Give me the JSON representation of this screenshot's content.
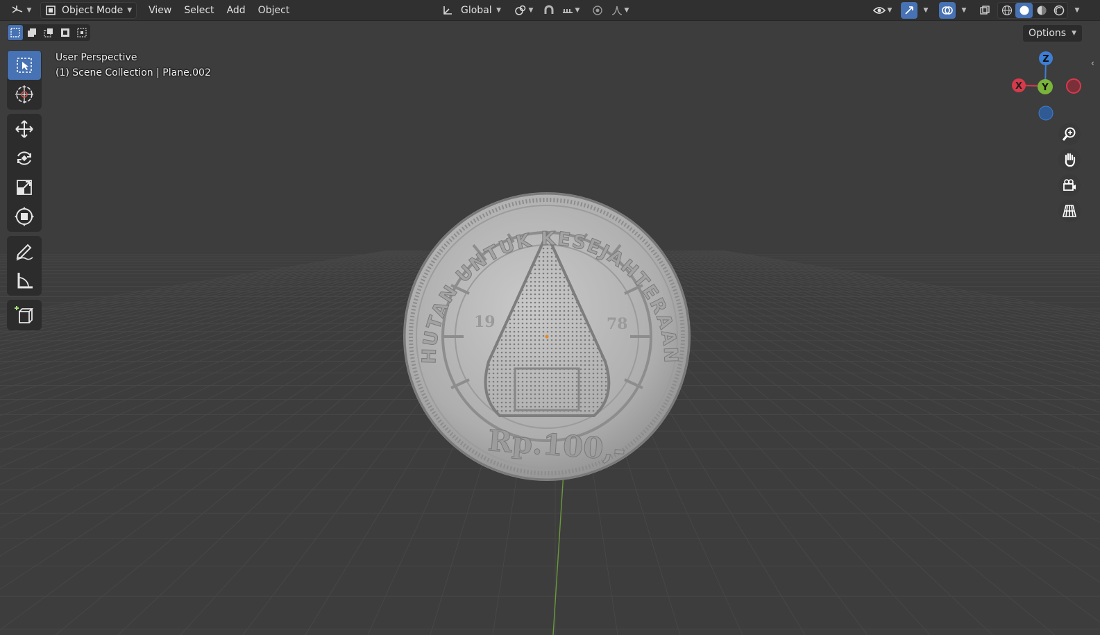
{
  "header": {
    "editor_type_icon": "3d-viewport-icon",
    "mode_label": "Object Mode",
    "menus": [
      "View",
      "Select",
      "Add",
      "Object"
    ],
    "transform_orientation": "Global"
  },
  "subheader": {
    "options_label": "Options"
  },
  "overlay": {
    "view_name": "User Perspective",
    "collection_info": "(1) Scene Collection | Plane.002"
  },
  "gizmo": {
    "x_label": "X",
    "y_label": "Y",
    "z_label": "Z",
    "x_color": "#d63a4b",
    "y_color": "#7ab43a",
    "z_color": "#3e7fd6"
  },
  "coin": {
    "top_text": "HUTAN UNTUK KESEJAHTERAAN",
    "year_left": "19",
    "year_right": "78",
    "denomination": "Rp.100,-"
  },
  "colors": {
    "accent": "#4772b3",
    "viewport_bg": "#3d3d3d",
    "header_bg": "#303030"
  }
}
